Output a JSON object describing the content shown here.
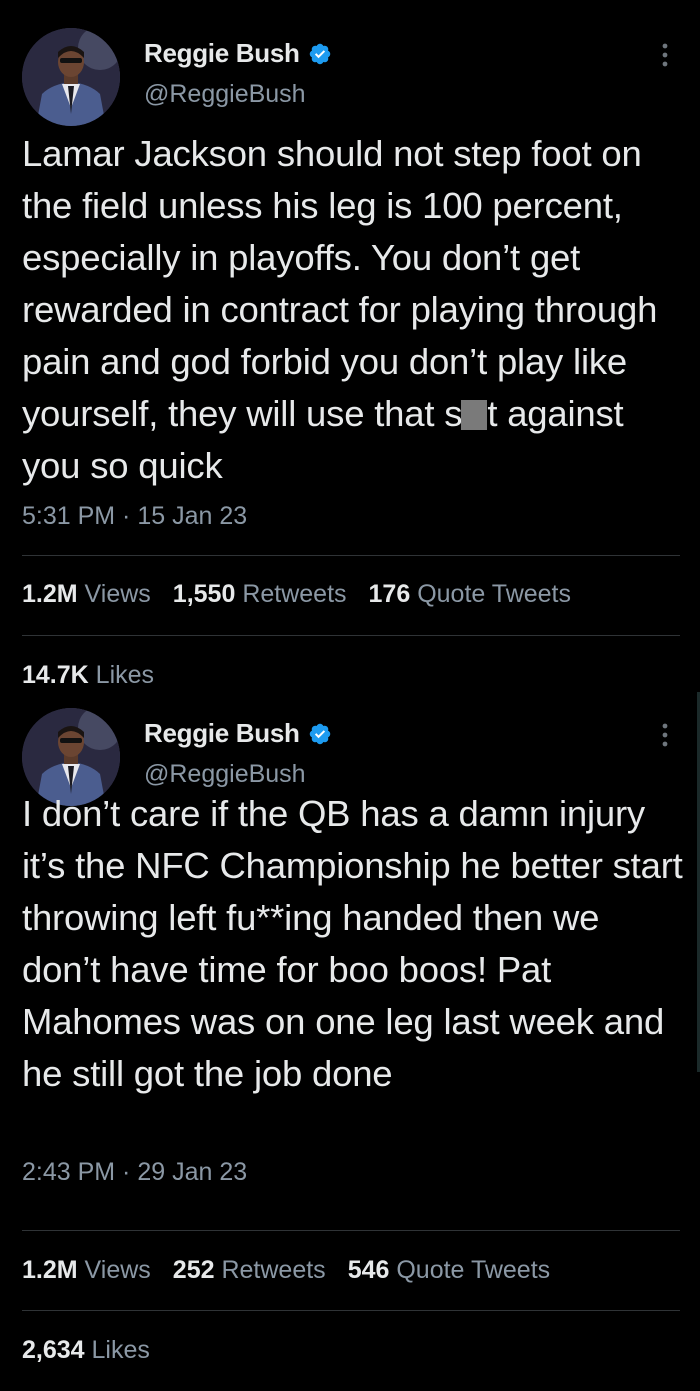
{
  "tweets": [
    {
      "display_name": "Reggie Bush",
      "handle": "@ReggieBush",
      "text_before_censor": "Lamar Jackson should not step foot on the field unless his leg is 100 percent, especially in playoffs. You don’t get rewarded in contract for playing through pain and god forbid you don’t play like yourself, they will use that s",
      "text_after_censor": "t against you so quick",
      "timestamp": "5:31 PM · 15 Jan 23",
      "views_count": "1.2M",
      "views_label": "Views",
      "retweets_count": "1,550",
      "retweets_label": "Retweets",
      "quotes_count": "176",
      "quotes_label": "Quote Tweets",
      "likes_count": "14.7K",
      "likes_label": "Likes"
    },
    {
      "display_name": "Reggie Bush",
      "handle": "@ReggieBush",
      "text": "I don’t care if the QB has a damn injury it’s the NFC Championship he better start throwing left fu**ing handed then we don’t have time for boo boos! Pat Mahomes was on one leg last week and he still got the job done",
      "timestamp": "2:43 PM · 29 Jan 23",
      "views_count": "1.2M",
      "views_label": "Views",
      "retweets_count": "252",
      "retweets_label": "Retweets",
      "quotes_count": "546",
      "quotes_label": "Quote Tweets",
      "likes_count": "2,634",
      "likes_label": "Likes"
    }
  ],
  "icons": {
    "verified": "verified-badge-icon",
    "more": "more-options-icon",
    "avatar": "profile-avatar"
  },
  "colors": {
    "background": "#000000",
    "primary_text": "#e7e9ea",
    "secondary_text": "#8b98a5",
    "verified_blue": "#1d9bf0",
    "divider": "#2f3336"
  }
}
